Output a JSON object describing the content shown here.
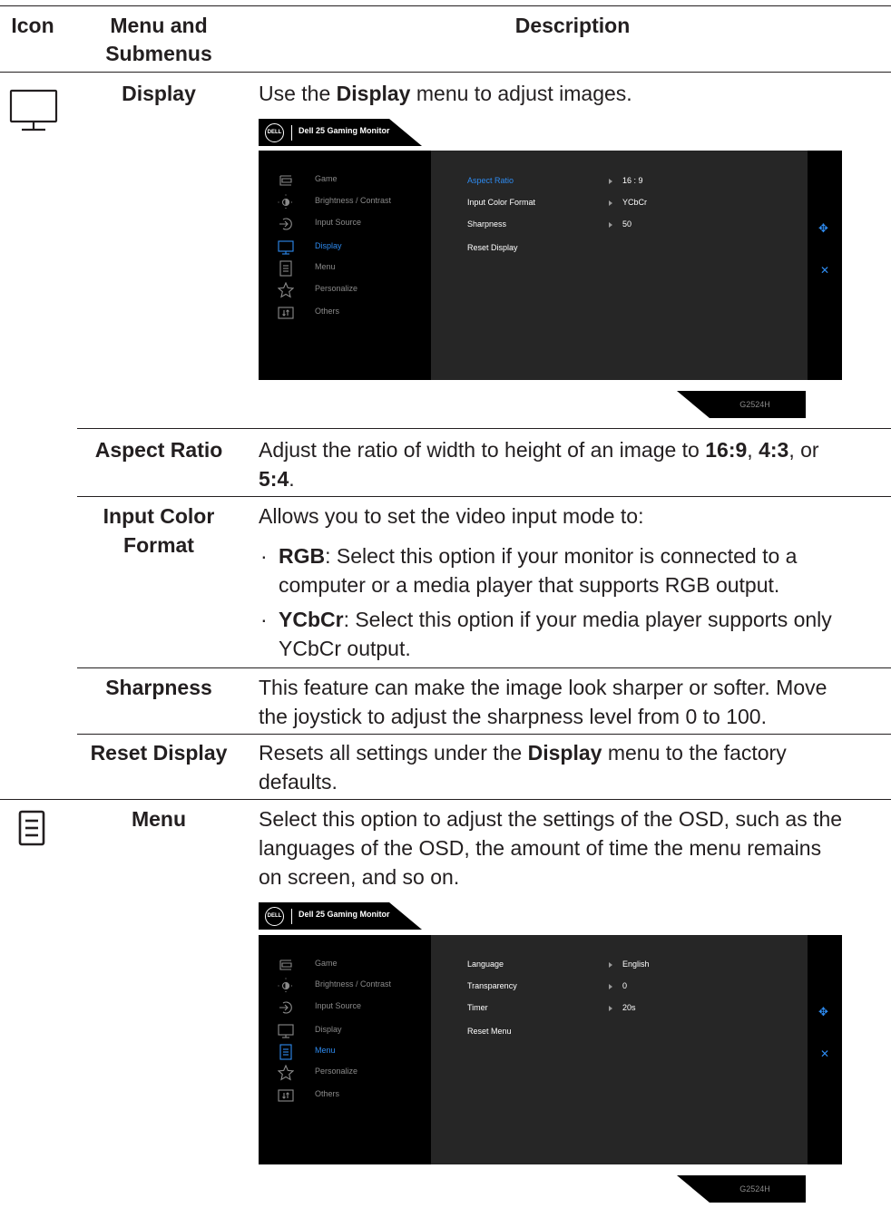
{
  "header": {
    "icon": "Icon",
    "menu_1": "Menu and",
    "menu_2": "Submenus",
    "description": "Description"
  },
  "display": {
    "icon": "monitor-icon",
    "label": "Display",
    "desc_pre": "Use the ",
    "desc_bold": "Display",
    "desc_post": " menu to adjust images."
  },
  "osd1": {
    "brand": "DELL",
    "title": "Dell 25 Gaming Monitor",
    "menu": [
      {
        "icon": "game-icon",
        "label": "Game"
      },
      {
        "icon": "brightness-icon",
        "label": "Brightness / Contrast"
      },
      {
        "icon": "input-source-icon",
        "label": "Input Source"
      },
      {
        "icon": "display-icon",
        "label": "Display"
      },
      {
        "icon": "menu-icon",
        "label": "Menu"
      },
      {
        "icon": "star-icon",
        "label": "Personalize"
      },
      {
        "icon": "others-icon",
        "label": "Others"
      }
    ],
    "active": "Display",
    "submenu": [
      {
        "label": "Aspect Ratio",
        "value": "16 : 9"
      },
      {
        "label": "Input Color Format",
        "value": "YCbCr"
      },
      {
        "label": "Sharpness",
        "value": "50"
      },
      {
        "label": "Reset Display",
        "value": ""
      }
    ],
    "model": "G2524H"
  },
  "aspect": {
    "label": "Aspect Ratio",
    "d1": "Adjust the ratio of width to height of an image to ",
    "b1": "16:9",
    "d2": ", ",
    "b2": "4:3",
    "d3": ", or",
    "b3": "5:4",
    "d4": "."
  },
  "icf": {
    "label_1": "Input Color",
    "label_2": "Format",
    "intro": "Allows you to set the video input mode to:",
    "bullet": "·",
    "rgb_bold": "RGB",
    "rgb_l1": ": Select this option if your monitor is connected to a",
    "rgb_l2": "computer or a media player that supports RGB output.",
    "ycbcr_bold": "YCbCr",
    "ycbcr_l1": ": Select this option if your media player supports only",
    "ycbcr_l2": "YCbCr output."
  },
  "sharpness": {
    "label": "Sharpness",
    "l1": "This feature can make the image look sharper or softer. Move",
    "l2": "the joystick to adjust the sharpness level from 0 to 100."
  },
  "reset": {
    "label": "Reset Display",
    "pre": "Resets all settings under the ",
    "bold": "Display",
    "post": " menu to the factory",
    "l2": "defaults."
  },
  "menu": {
    "icon": "menu-icon",
    "label": "Menu",
    "l1": "Select this option to adjust the settings of the OSD, such as the",
    "l2": "languages of the OSD, the amount of time the menu remains",
    "l3": "on screen, and so on."
  },
  "osd2": {
    "brand": "DELL",
    "title": "Dell 25 Gaming Monitor",
    "active": "Menu",
    "submenu": [
      {
        "label": "Language",
        "value": "English"
      },
      {
        "label": "Transparency",
        "value": "0"
      },
      {
        "label": "Timer",
        "value": "20s"
      },
      {
        "label": "Reset Menu",
        "value": ""
      }
    ],
    "model": "G2524H"
  },
  "colors": {
    "accent": "#2e8bf0",
    "osd_bg": "#000000",
    "osd_panel": "#262626",
    "text": "#231f20"
  }
}
